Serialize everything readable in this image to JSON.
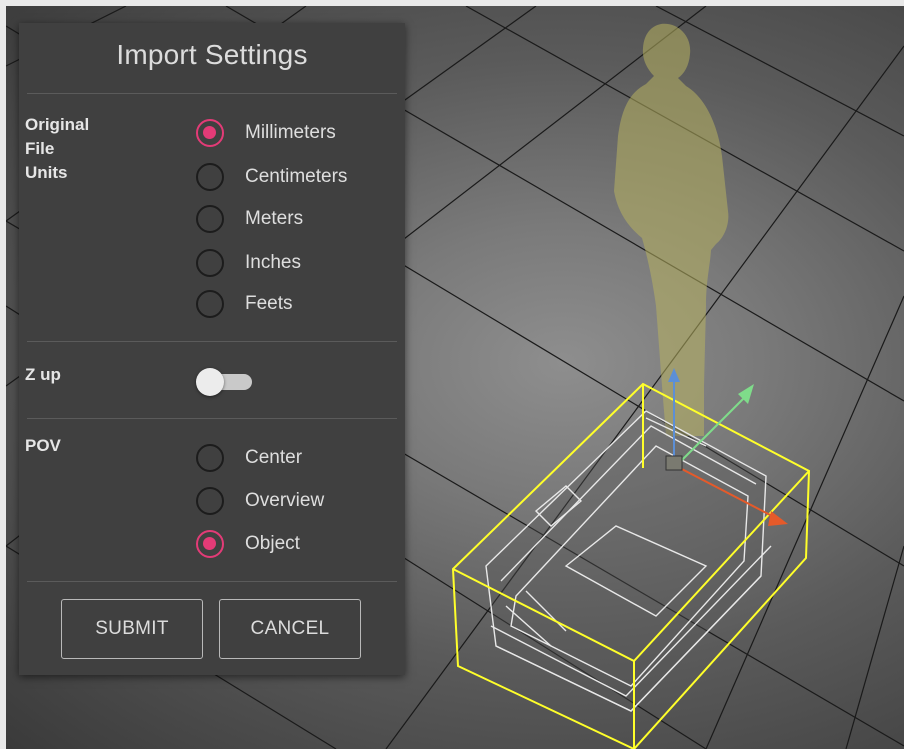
{
  "dialog": {
    "title": "Import Settings",
    "units_section": {
      "label_lines": [
        "Original",
        "File",
        "Units"
      ],
      "options": [
        {
          "label": "Millimeters",
          "checked": true
        },
        {
          "label": "Centimeters",
          "checked": false
        },
        {
          "label": "Meters",
          "checked": false
        },
        {
          "label": "Inches",
          "checked": false
        },
        {
          "label": "Feets",
          "checked": false
        }
      ]
    },
    "zup_section": {
      "label": "Z up",
      "enabled": false
    },
    "pov_section": {
      "label": "POV",
      "options": [
        {
          "label": "Center",
          "checked": false
        },
        {
          "label": "Overview",
          "checked": false
        },
        {
          "label": "Object",
          "checked": true
        }
      ]
    },
    "buttons": {
      "submit": "SUBMIT",
      "cancel": "CANCEL"
    }
  },
  "colors": {
    "accent": "#e33b77",
    "panel_bg": "#404040",
    "bounding_box": "#ffff2a",
    "axis_x": "#e55a2a",
    "axis_y": "#7fdc8a",
    "axis_z": "#5c8fd6"
  }
}
